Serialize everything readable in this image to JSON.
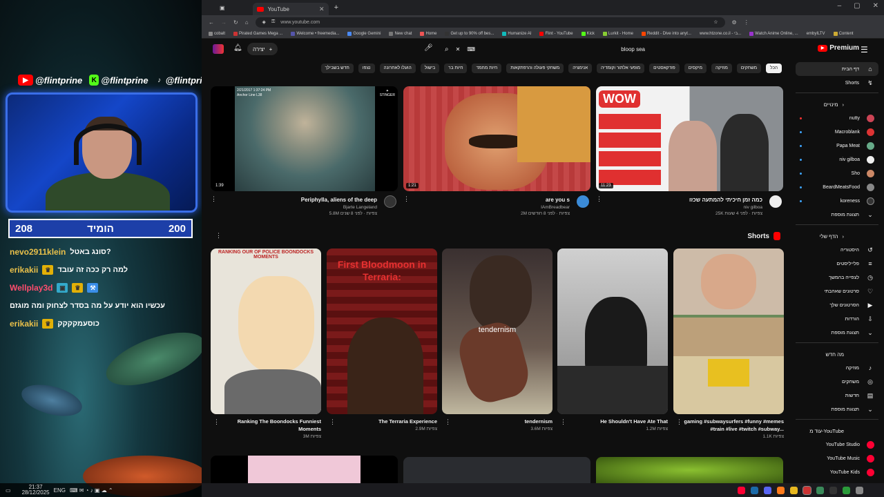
{
  "overlay": {
    "socials": [
      "@flintprine",
      "@flintprine",
      "@flintprine"
    ],
    "score": {
      "left": "208",
      "title": "הומיד",
      "right": "200"
    },
    "chat": [
      {
        "user": "nevo2911klein",
        "msg": "סונג באטל?",
        "color": "#e9c04a"
      },
      {
        "user": "erikakii",
        "msg": "למה רק ככה זה עובד",
        "color": "#e9c04a"
      },
      {
        "user": "Wellplay3d",
        "msg": "",
        "color": "#ff4d6d"
      },
      {
        "user": "",
        "msg": "עכשיו הוא יודע על מה בסדר לצחוק ומה מוגזם",
        "color": "#fff"
      },
      {
        "user": "erikakii",
        "msg": "כוסעמקקקק",
        "color": "#e9c04a"
      }
    ],
    "taskbar": {
      "time": "21:37",
      "date": "28/12/2025",
      "lang": "ENG"
    }
  },
  "browser": {
    "tab_title": "YouTube",
    "url": "www.youtube.com",
    "bookmarks": [
      "cobalt",
      "Pirated Games Mega ...",
      "Welcome • freemedia...",
      "Google Gemini",
      "New chat",
      "Home",
      "Get up to 90% off bes...",
      "Humanize AI",
      "Flint - YouTube",
      "Kick",
      "Lurkit - Home",
      "Reddit - Dive into anyt...",
      "www.htzone.co.il - בי...",
      "Watch Anime Online, ...",
      "embyILTV",
      "Content"
    ]
  },
  "yt": {
    "logo": "Premium",
    "search_query": "bloop sea",
    "create_label": "יצירה",
    "chips": [
      "הכל",
      "משחקים",
      "מוזיקה",
      "מיקסים",
      "פודקאסטים",
      "מופעי אלתור וקומדיה",
      "אנימציה",
      "משחקי פעולה והרפתקאות",
      "חיות מחמד",
      "חיות בר",
      "בישול",
      "הועלו לאחרונה",
      "נצפו",
      "חדש בשבילך"
    ],
    "sidebar": {
      "main": [
        {
          "label": "דף הבית",
          "icon": "⌂"
        },
        {
          "label": "Shorts",
          "icon": "↯"
        }
      ],
      "subs_head": "מינויים",
      "subs": [
        {
          "label": "nutty",
          "color": "#c45"
        },
        {
          "label": "Macroblank",
          "color": "#d33"
        },
        {
          "label": "Papa Meat",
          "color": "#6a8"
        },
        {
          "label": "niv gilboa",
          "color": "#eee"
        },
        {
          "label": "Sho",
          "color": "#c86"
        },
        {
          "label": "BeardMeatsFood",
          "color": "#888"
        },
        {
          "label": "koreness",
          "color": "#333"
        },
        {
          "label": "תצוגת מוספת",
          "color": ""
        }
      ],
      "you_head": "הדף שלי",
      "you": [
        {
          "label": "היסטוריה",
          "icon": "↺"
        },
        {
          "label": "פלייליסטים",
          "icon": "≡"
        },
        {
          "label": "לצפייה בהמשך",
          "icon": "◷"
        },
        {
          "label": "סרטונים שאהבתי",
          "icon": "♡"
        },
        {
          "label": "הסרטונים שלך",
          "icon": "▶"
        },
        {
          "label": "הורדות",
          "icon": "⇩"
        },
        {
          "label": "תצוגת מוספת",
          "icon": "⌄"
        }
      ],
      "explore_head": "מה חדש",
      "explore": [
        {
          "label": "מוזיקה",
          "icon": "♪"
        },
        {
          "label": "משחקים",
          "icon": "◎"
        },
        {
          "label": "חדשות",
          "icon": "▤"
        },
        {
          "label": "תצוגת מוספת",
          "icon": "⌄"
        }
      ],
      "more_head": "עוד מ-YouTube",
      "more": [
        {
          "label": "YouTube Studio"
        },
        {
          "label": "YouTube Music"
        },
        {
          "label": "YouTube Kids"
        }
      ]
    },
    "videos": [
      {
        "title": "Periphylla, aliens of the deep",
        "channel": "Bjarte Langeland",
        "stats": "5.8M צפיות · לפני 8 שנים",
        "duration": "1:39",
        "thumb_text": "2/21/2017 1:37:24 PM\nAnchor Line L38"
      },
      {
        "title": "are you s",
        "channel": "IAmBreadbear",
        "stats": "2M צפיות · לפני 8 חודשים",
        "duration": "1:21",
        "thumb_text": ""
      },
      {
        "title": "כמה זמן חיכיתי להמתעה שכזו",
        "channel": "niv gilboa",
        "stats": "25K צפיות · לפני 4 שעות",
        "duration": "11:23",
        "thumb_text": "WOW"
      }
    ],
    "shorts_label": "Shorts",
    "shorts": [
      {
        "title": "Ranking The Boondocks Funniest Moments",
        "views": "3M צפיות",
        "thumb_text": "RANKING OUR OF POLICE BOONDOCKS MOMENTS"
      },
      {
        "title": "The Terraria Experience",
        "views": "2.9M צפיות",
        "thumb_text": "First Bloodmoon in Terraria:"
      },
      {
        "title": "tendernism",
        "views": "3.6M צפיות",
        "thumb_text": "tendernism"
      },
      {
        "title": "He Shouldn't Have Ate That",
        "views": "1.2M צפיות",
        "thumb_text": ""
      },
      {
        "title": "gaming #subwaysurfers #funny #memes #train #live #twitch #subway...",
        "views": "1.1K צפיות",
        "thumb_text": ""
      }
    ]
  }
}
